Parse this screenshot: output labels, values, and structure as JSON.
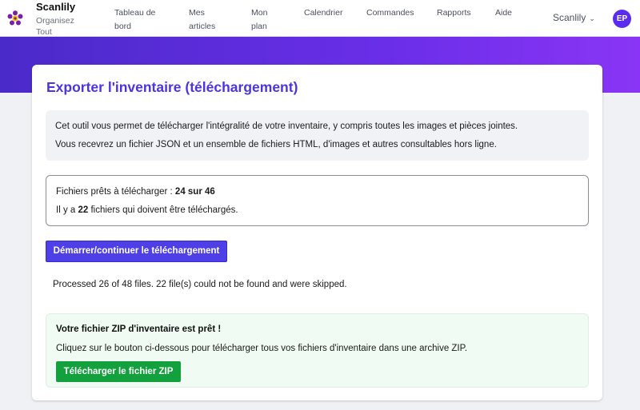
{
  "brand": {
    "name": "Scanlily",
    "tagline": "Organisez Tout",
    "logo_icon": "flower-logo-icon"
  },
  "nav": {
    "items": [
      {
        "label": "Tableau de bord"
      },
      {
        "label": "Mes articles"
      },
      {
        "label": "Mon plan"
      },
      {
        "label": "Calendrier"
      },
      {
        "label": "Commandes"
      },
      {
        "label": "Rapports"
      },
      {
        "label": "Aide"
      }
    ],
    "user_menu_label": "Scanlily",
    "user_menu_icon": "chevron-down-icon",
    "avatar_initials": "EP"
  },
  "colors": {
    "accent": "#4c34e0",
    "band_start": "#4a2ac9",
    "band_end": "#8a35f5",
    "success": "#12a13c"
  },
  "card": {
    "title": "Exporter l'inventaire (téléchargement)",
    "info": {
      "line1": "Cet outil vous permet de télécharger l'intégralité de votre inventaire, y compris toutes les images et pièces jointes.",
      "line2": "Vous recevrez un fichier JSON et un ensemble de fichiers HTML, d'images et autres consultables hors ligne."
    },
    "status": {
      "ready_prefix": "Fichiers prêts à télécharger : ",
      "ready_value": "24 sur 46",
      "remaining_prefix": "Il y a ",
      "remaining_count": "22",
      "remaining_suffix": " fichiers qui doivent être téléchargés."
    },
    "start_button_label": "Démarrer/continuer le téléchargement",
    "processed_text": "Processed 26 of 48 files. 22 file(s) could not be found and were skipped.",
    "success": {
      "title": "Votre fichier ZIP d'inventaire est prêt !",
      "description": "Cliquez sur le bouton ci-dessous pour télécharger tous vos fichiers d'inventaire dans une archive ZIP.",
      "button_label": "Télécharger le fichier ZIP"
    }
  }
}
